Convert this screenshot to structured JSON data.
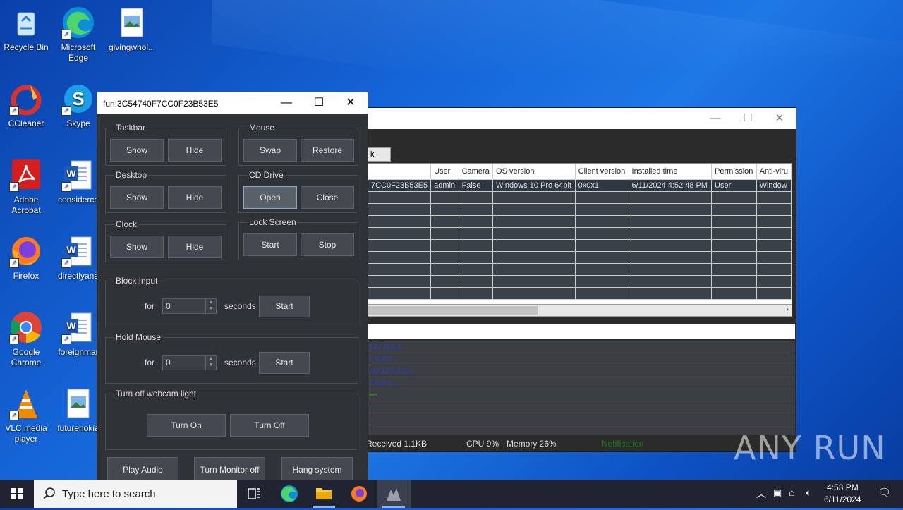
{
  "desktop": {
    "icons": [
      {
        "label": "Recycle Bin",
        "icon": "recycle-bin-icon"
      },
      {
        "label": "Microsoft Edge",
        "icon": "edge-icon"
      },
      {
        "label": "givingwhol...",
        "icon": "image-file-icon"
      },
      {
        "label": "CCleaner",
        "icon": "ccleaner-icon"
      },
      {
        "label": "Skype",
        "icon": "skype-icon"
      },
      {
        "label": "Adobe Acrobat",
        "icon": "acrobat-icon"
      },
      {
        "label": "considerco",
        "icon": "word-doc-icon"
      },
      {
        "label": "Firefox",
        "icon": "firefox-icon"
      },
      {
        "label": "directlyana",
        "icon": "word-doc-icon"
      },
      {
        "label": "Google Chrome",
        "icon": "chrome-icon"
      },
      {
        "label": "foreignmar",
        "icon": "word-doc-icon"
      },
      {
        "label": "VLC media player",
        "icon": "vlc-icon"
      },
      {
        "label": "futurenokia",
        "icon": "image-file-icon"
      }
    ]
  },
  "back_window": {
    "tab_partial": "k",
    "columns": [
      "",
      "User",
      "Camera",
      "OS version",
      "Client version",
      "Installed time",
      "Permission",
      "Anti-viru"
    ],
    "row": [
      "7CC0F23B53E5",
      "admin",
      "False",
      "Windows 10 Pro 64bit",
      "0x0x1",
      "6/11/2024 4:52:48 PM",
      "User",
      "Window"
    ],
    "log_lines": [
      "127.0.0.1",
      "7.0.0.1 ...",
      "l lo 127.0.0.1",
      "7.0.0.1 ..."
    ],
    "status": {
      "received": "Received  1.1KB",
      "cpu": "CPU 9%",
      "memory": "Memory 26%",
      "notification": "Notification"
    }
  },
  "fun_window": {
    "title": "fun:3C54740F7CC0F23B53E5",
    "taskbar": {
      "label": "Taskbar",
      "show": "Show",
      "hide": "Hide"
    },
    "mouse": {
      "label": "Mouse",
      "swap": "Swap",
      "restore": "Restore"
    },
    "desktop": {
      "label": "Desktop",
      "show": "Show",
      "hide": "Hide"
    },
    "cd_drive": {
      "label": "CD Drive",
      "open": "Open",
      "close": "Close"
    },
    "clock": {
      "label": "Clock",
      "show": "Show",
      "hide": "Hide"
    },
    "lock_screen": {
      "label": "Lock Screen",
      "start": "Start",
      "stop": "Stop"
    },
    "block_input": {
      "label": "Block Input",
      "for": "for",
      "value": "0",
      "seconds": "seconds",
      "start": "Start"
    },
    "hold_mouse": {
      "label": "Hold Mouse",
      "for": "for",
      "value": "0",
      "seconds": "seconds",
      "start": "Start"
    },
    "webcam": {
      "label": "Turn off webcam light",
      "on": "Turn On",
      "off": "Turn Off"
    },
    "bottom": {
      "play_audio": "Play Audio",
      "monitor_off": "Turn Monitor off",
      "hang": "Hang system"
    }
  },
  "taskbar": {
    "search_placeholder": "Type here to search",
    "time": "4:53 PM",
    "date": "6/11/2024"
  },
  "watermark": "ANY RUN"
}
